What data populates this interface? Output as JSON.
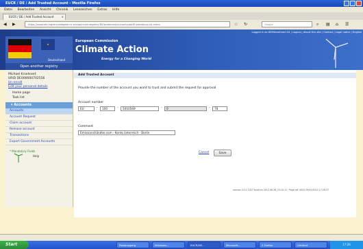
{
  "window": {
    "title": "EUCR / DE / Add Trusted Account - Mozilla Firefox",
    "menu": [
      "Datei",
      "Bearbeiten",
      "Ansicht",
      "Chronik",
      "Lesezeichen",
      "Extras",
      "Hilfe"
    ]
  },
  "tab": {
    "label": "EUCR / DE / Add Trusted Account"
  },
  "nav": {
    "url": "https://www.ets-registry.webgate.ec.europa.eu/euregistry/DE/protected/accounts/addTrustedAccount.xhtml",
    "search_placeholder": "Google"
  },
  "banner": {
    "logged_in": "Logged in as DEMIkrsehner134 | Logout | About this site | Contact | Legal notice | English",
    "commission": "European Commission",
    "title": "Climate Action",
    "tagline": "Energy for a Changing World",
    "country": "Deutschland",
    "open_registry": "Open another registry"
  },
  "sidebar": {
    "user_name": "Michael Krsehnert",
    "urid": "URID DE000000702556",
    "unenroll": "Un-enroll",
    "edit_details": "Edit your personal details",
    "home": "Home page",
    "task_list": "Task list",
    "accounts_header": "Accounts",
    "items": [
      "Accounts",
      "Account Request",
      "Claim account",
      "Release account",
      "Transactions",
      "Export Government Accounts"
    ],
    "mandatory": "* Mandatory Fields",
    "help": "Help"
  },
  "main": {
    "header": "Add Trusted Account",
    "instruction": "Provide the number of the account you want to trust and submit the request for approval",
    "account_label": "Account number",
    "fields": [
      "EU",
      "100",
      "5010569",
      "0",
      "78"
    ],
    "comment_label": "Comment",
    "comment": "Emissionshändler.com - Konto österreich - Berlin",
    "cancel": "Cancel",
    "save": "Save"
  },
  "footer": "version 4.5.1 1427 build on 2012-06-28_15:15:11 · Page ref: 0001 09/10/2012 17:26:37",
  "taskbar": {
    "start": "Start",
    "items": [
      "Postausgang",
      "Windows...",
      "EUCR/DE...",
      "Microsoft...",
      "2 Firefox",
      "Untitled"
    ],
    "clock": "17:26"
  },
  "colors": {
    "banner": "#2f5fba",
    "sidebar_header": "#6a9fd9",
    "page_bg": "#fbf3cf"
  }
}
